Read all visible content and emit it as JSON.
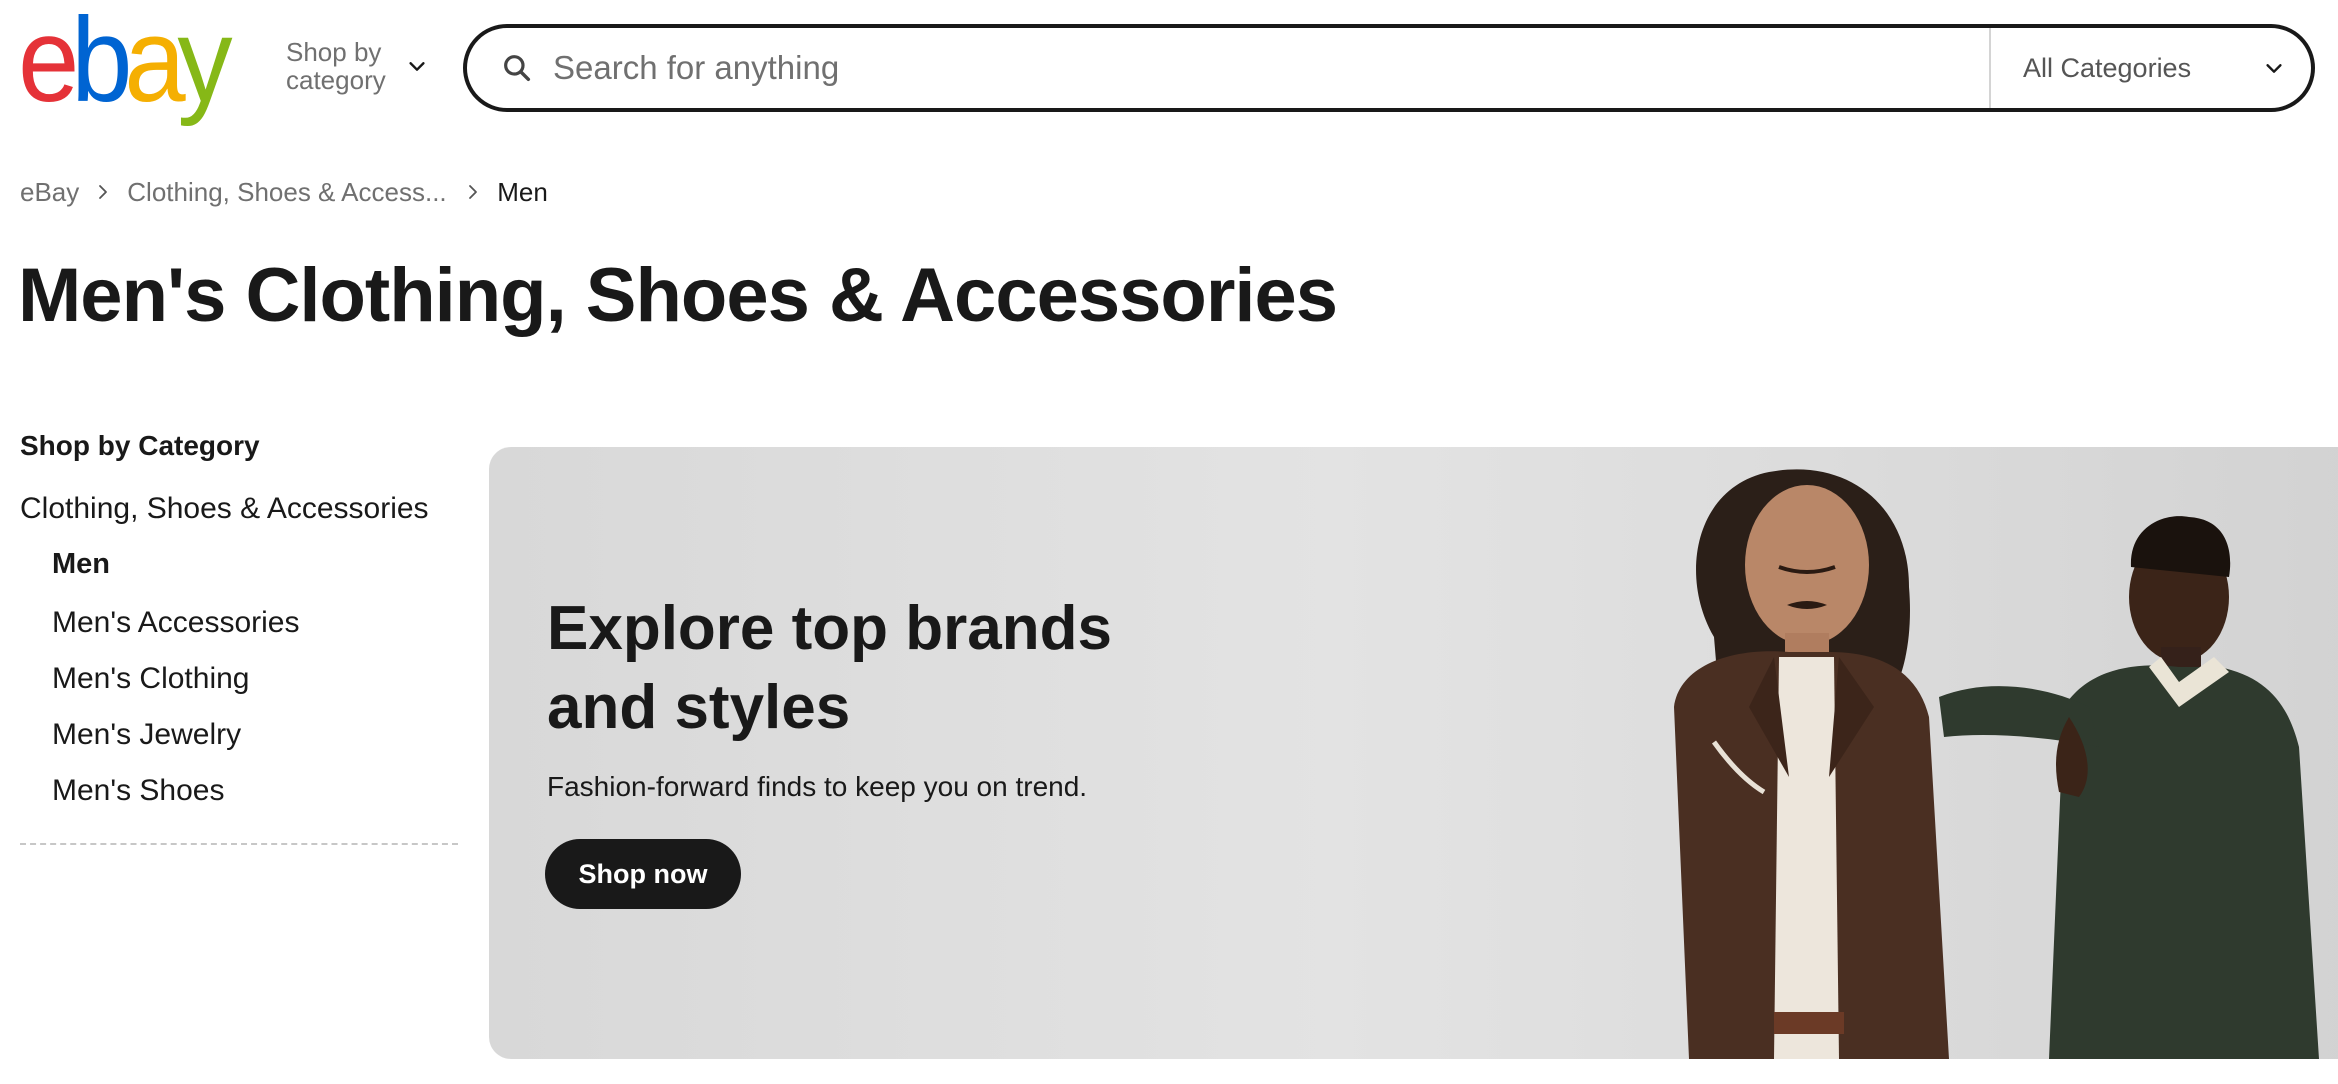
{
  "header": {
    "logo_letters": [
      {
        "char": "e",
        "color": "#e53238"
      },
      {
        "char": "b",
        "color": "#0064d2"
      },
      {
        "char": "a",
        "color": "#f5af02"
      },
      {
        "char": "y",
        "color": "#86b817"
      }
    ],
    "shop_by_category": "Shop by category",
    "search_placeholder": "Search for anything",
    "category_select": "All Categories"
  },
  "breadcrumb": {
    "items": [
      "eBay",
      "Clothing, Shoes & Access...",
      "Men"
    ]
  },
  "page_title": "Men's Clothing, Shoes & Accessories",
  "sidebar": {
    "heading": "Shop by Category",
    "parent": "Clothing, Shoes & Accessories",
    "current": "Men",
    "items": [
      "Men's Accessories",
      "Men's Clothing",
      "Men's Jewelry",
      "Men's Shoes"
    ]
  },
  "hero": {
    "title": "Explore top brands and styles",
    "subtitle": "Fashion-forward finds to keep you on trend.",
    "button": "Shop now"
  },
  "icons": {
    "search": "search-icon",
    "chevron": "chevron-down-icon",
    "breadcrumb_separator": "chevron-right-icon"
  }
}
